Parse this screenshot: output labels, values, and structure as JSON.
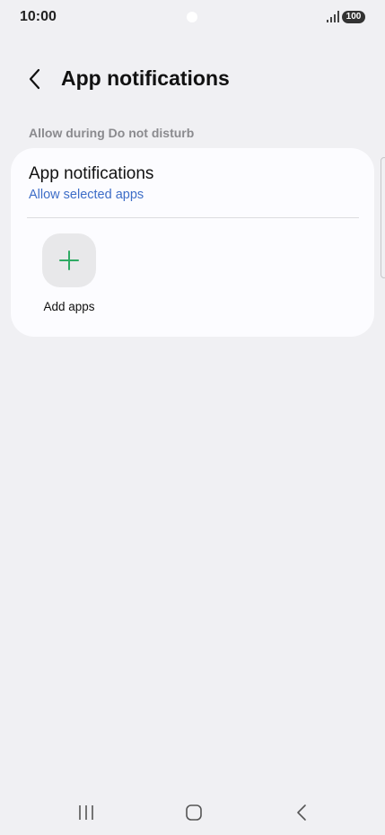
{
  "status_bar": {
    "time": "10:00",
    "battery": "100",
    "icons": [
      "signal-icon",
      "battery-icon"
    ]
  },
  "header": {
    "title": "App notifications",
    "back_icon": "back-arrow-icon"
  },
  "section": {
    "label": "Allow during Do not disturb"
  },
  "setting": {
    "title": "App notifications",
    "value": "Allow selected apps"
  },
  "add_apps": {
    "label": "Add apps",
    "icon": "plus-icon"
  },
  "nav_bar": {
    "icons": [
      "recents-icon",
      "home-icon",
      "back-icon"
    ]
  },
  "colors": {
    "background": "#f0f0f3",
    "card": "#fcfcff",
    "accent_link": "#3d6dc7",
    "plus_green": "#2faa64"
  }
}
